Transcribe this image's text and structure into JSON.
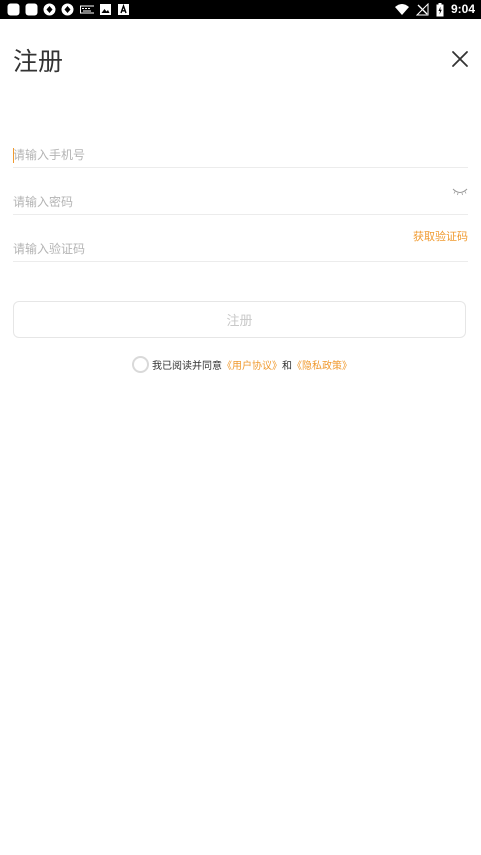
{
  "status_bar": {
    "time": "9:04",
    "left_icons": [
      "app-icon",
      "app-icon",
      "sync-icon",
      "sync-icon",
      "keyboard-icon",
      "image-icon",
      "font-icon"
    ],
    "right_icons": [
      "wifi-icon",
      "no-signal-icon",
      "battery-charging-icon"
    ]
  },
  "header": {
    "title": "注册"
  },
  "form": {
    "phone_placeholder": "请输入手机号",
    "password_placeholder": "请输入密码",
    "code_placeholder": "请输入验证码",
    "get_code_label": "获取验证码",
    "submit_label": "注册"
  },
  "agreement": {
    "prefix": "我已阅读并同意",
    "user_agreement": "《用户协议》",
    "and": "和",
    "privacy_policy": "《隐私政策》"
  },
  "colors": {
    "accent": "#f09a2f",
    "placeholder": "#b4b4b4",
    "divider": "#ececec"
  }
}
